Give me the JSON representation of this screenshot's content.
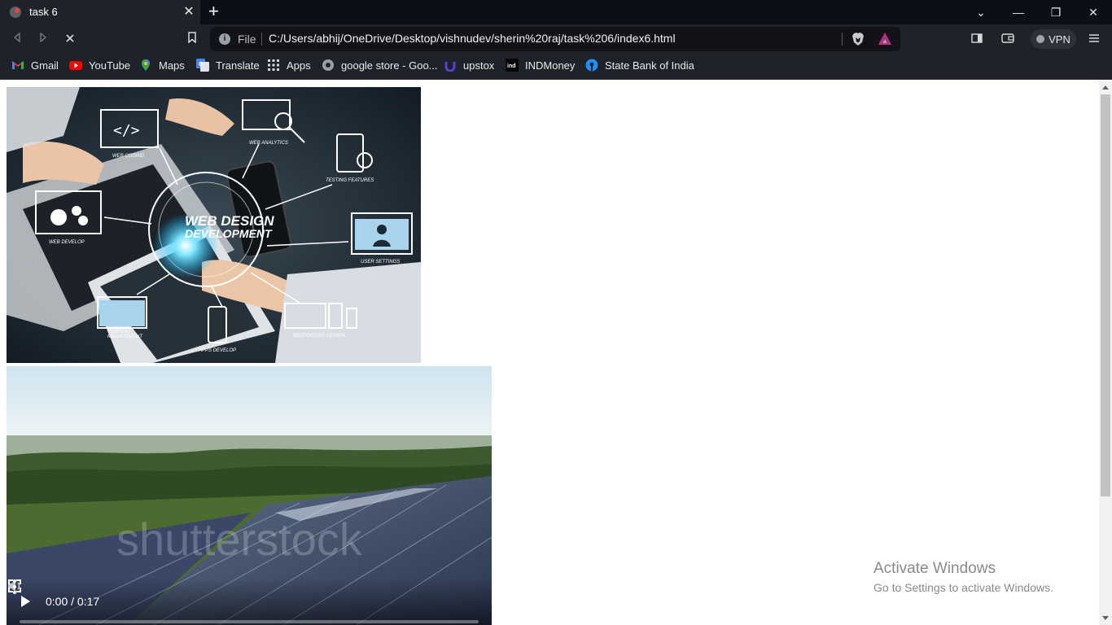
{
  "browser": {
    "tab": {
      "title": "task 6",
      "close": "✕"
    },
    "new_tab": "+",
    "window_controls": {
      "list_tabs": "⌄",
      "minimize": "—",
      "restore": "❐",
      "close": "✕"
    },
    "omnibox": {
      "scheme_label": "File",
      "url": "C:/Users/abhij/OneDrive/Desktop/vishnudev/sherin%20raj/task%206/index6.html"
    },
    "vpn_label": "VPN",
    "bookmarks": [
      {
        "label": "Gmail",
        "icon": "gmail-icon"
      },
      {
        "label": "YouTube",
        "icon": "youtube-icon"
      },
      {
        "label": "Maps",
        "icon": "maps-icon"
      },
      {
        "label": "Translate",
        "icon": "translate-icon"
      },
      {
        "label": "Apps",
        "icon": "apps-grid-icon"
      },
      {
        "label": "google store - Goo...",
        "icon": "globe-icon"
      },
      {
        "label": "upstox",
        "icon": "upstox-icon"
      },
      {
        "label": "INDMoney",
        "icon": "indmoney-icon"
      },
      {
        "label": "State Bank of India",
        "icon": "sbi-icon"
      }
    ]
  },
  "page": {
    "hero_image": {
      "heading_line1": "WEB DESIGN",
      "heading_line2": "DEVELOPMENT",
      "labels": {
        "web_coding": "WEB CODING",
        "web_analytics": "WEB ANALYTICS",
        "testing_features": "TESTING FEATURES",
        "web_develop": "WEB DEVELOP",
        "user_settings": "USER SETTINGS",
        "content_management_1": "CONTENT",
        "content_management_2": "MANAGEMENT",
        "apps_develop": "APPS DEVELOP",
        "responsive_design": "RESPONSIVE DESIGN"
      }
    },
    "video": {
      "watermark": "shutterstock",
      "time": "0:00 / 0:17",
      "progress": 0
    }
  },
  "system": {
    "activate_title": "Activate Windows",
    "activate_sub": "Go to Settings to activate Windows."
  },
  "colors": {
    "tabstrip_bg": "#0d0f18",
    "toolbar_bg": "#1f2229",
    "omnibox_bg": "#111318"
  }
}
